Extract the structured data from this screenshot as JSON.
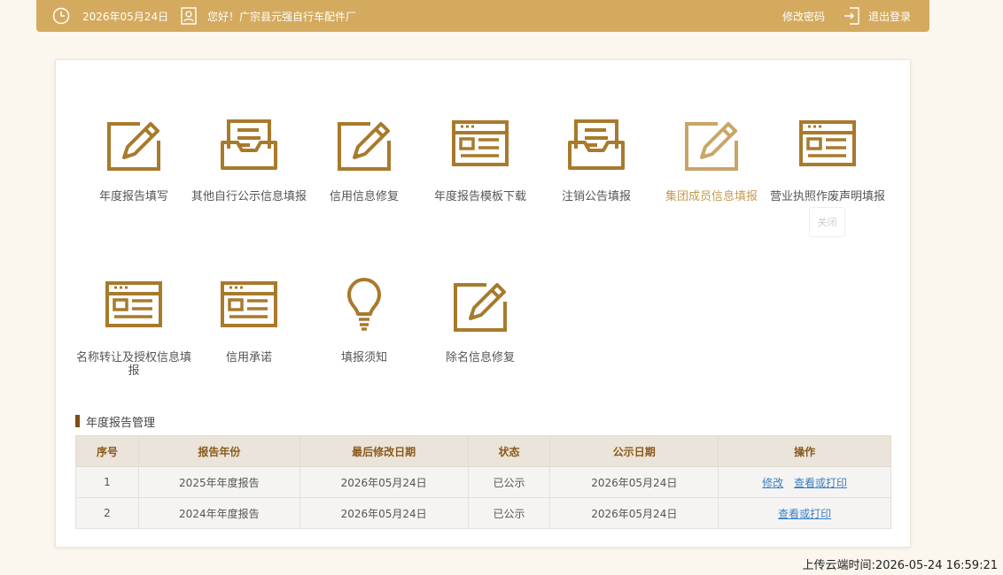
{
  "header": {
    "date": "2026年05月24日",
    "greeting": "您好！广宗县元强自行车配件厂",
    "change_password": "修改密码",
    "logout": "退出登录"
  },
  "menu": [
    {
      "label": "年度报告填写",
      "icon": "edit-icon"
    },
    {
      "label": "其他自行公示信息填报",
      "icon": "inbox-icon"
    },
    {
      "label": "信用信息修复",
      "icon": "edit-icon"
    },
    {
      "label": "年度报告模板下载",
      "icon": "template-icon"
    },
    {
      "label": "注销公告填报",
      "icon": "inbox-icon"
    },
    {
      "label": "集团成员信息填报",
      "icon": "edit-icon",
      "active": true
    },
    {
      "label": "营业执照作废声明填报",
      "icon": "template-icon"
    },
    {
      "label": "名称转让及授权信息填报",
      "icon": "template-icon"
    },
    {
      "label": "信用承诺",
      "icon": "template-icon"
    },
    {
      "label": "填报须知",
      "icon": "lightbulb-icon"
    },
    {
      "label": "除名信息修复",
      "icon": "edit-icon"
    }
  ],
  "close_tip": "关闭",
  "section": {
    "title": "年度报告管理"
  },
  "table": {
    "headers": [
      "序号",
      "报告年份",
      "最后修改日期",
      "状态",
      "公示日期",
      "操作"
    ],
    "rows": [
      {
        "no": "1",
        "year": "2025年年度报告",
        "modified": "2026年05月24日",
        "status": "已公示",
        "published": "2026年05月24日",
        "actions": [
          "修改",
          "查看或打印"
        ]
      },
      {
        "no": "2",
        "year": "2024年年度报告",
        "modified": "2026年05月24日",
        "status": "已公示",
        "published": "2026年05月24日",
        "actions": [
          "查看或打印"
        ]
      }
    ]
  },
  "footer": {
    "upload_time": "上传云端时间:2026-05-24 16:59:21"
  },
  "colors": {
    "gold": "#d4aa5f",
    "icon": "#a87a2c",
    "icon_active": "#c9a566",
    "link": "#3b7ec4"
  }
}
